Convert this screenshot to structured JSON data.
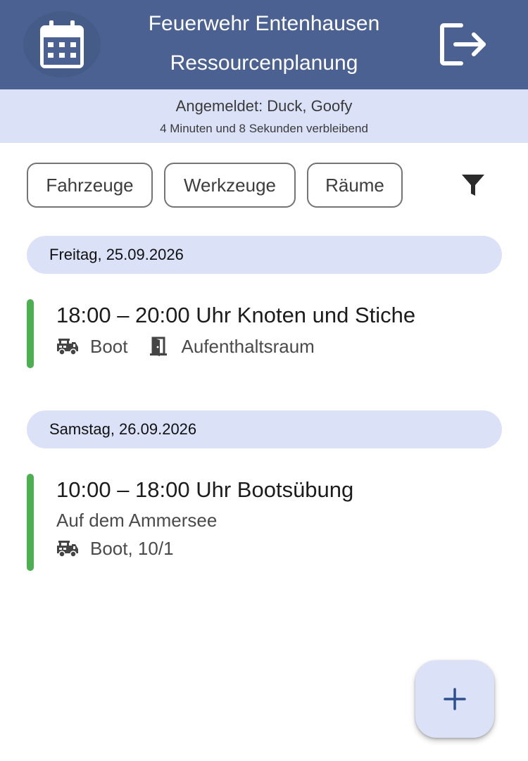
{
  "header": {
    "title_line1": "Feuerwehr Entenhausen",
    "title_line2": "Ressourcenplanung",
    "calendar_icon": "calendar-icon",
    "logout_icon": "logout-icon",
    "background_color": "#4a6191"
  },
  "session": {
    "logged_in": "Angemeldet: Duck, Goofy",
    "remaining": "4 Minuten und 8 Sekunden verbleibend"
  },
  "filters": {
    "chips": [
      "Fahrzeuge",
      "Werkzeuge",
      "Räume"
    ],
    "filter_icon": "filter-icon"
  },
  "days": [
    {
      "label": "Freitag, 25.09.2026",
      "events": [
        {
          "title": "18:00 – 20:00 Uhr Knoten und Stiche",
          "resources": [
            {
              "icon": "fire-truck-icon",
              "label": "Boot"
            },
            {
              "icon": "door-icon",
              "label": "Aufenthaltsraum"
            }
          ],
          "accent_color": "#4caf50"
        }
      ]
    },
    {
      "label": "Samstag, 26.09.2026",
      "events": [
        {
          "title": "10:00 – 18:00 Uhr Bootsübung",
          "description": "Auf dem Ammersee",
          "resources": [
            {
              "icon": "fire-truck-icon",
              "label": "Boot, 10/1"
            }
          ],
          "accent_color": "#4caf50"
        }
      ]
    }
  ],
  "fab": {
    "icon": "plus-icon",
    "accent_color": "#2f4f8f"
  }
}
